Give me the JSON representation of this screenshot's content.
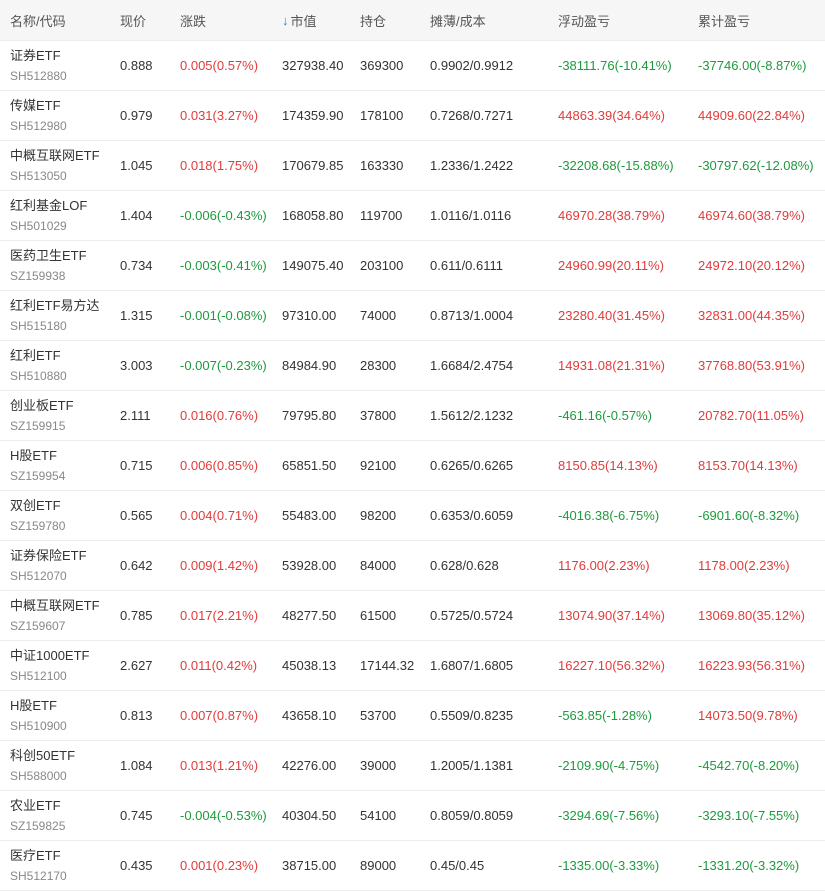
{
  "colors": {
    "up": "#e03b3b",
    "down": "#1c9b3c",
    "sort_arrow": "#2a7fd4"
  },
  "header": {
    "name_code": "名称/代码",
    "price": "现价",
    "change": "涨跌",
    "sort_icon": "arrow-down-icon",
    "market_value": "市值",
    "holding": "持仓",
    "cost": "摊薄/成本",
    "floating_pnl": "浮动盈亏",
    "cumulative_pnl": "累计盈亏"
  },
  "rows": [
    {
      "name": "证券ETF",
      "code": "SH512880",
      "price": "0.888",
      "change": "0.005(0.57%)",
      "market_value": "327938.40",
      "holding": "369300",
      "cost": "0.9902/0.9912",
      "floating": "-38111.76(-10.41%)",
      "cumulative": "-37746.00(-8.87%)"
    },
    {
      "name": "传媒ETF",
      "code": "SH512980",
      "price": "0.979",
      "change": "0.031(3.27%)",
      "market_value": "174359.90",
      "holding": "178100",
      "cost": "0.7268/0.7271",
      "floating": "44863.39(34.64%)",
      "cumulative": "44909.60(22.84%)"
    },
    {
      "name": "中概互联网ETF",
      "code": "SH513050",
      "price": "1.045",
      "change": "0.018(1.75%)",
      "market_value": "170679.85",
      "holding": "163330",
      "cost": "1.2336/1.2422",
      "floating": "-32208.68(-15.88%)",
      "cumulative": "-30797.62(-12.08%)"
    },
    {
      "name": "红利基金LOF",
      "code": "SH501029",
      "price": "1.404",
      "change": "-0.006(-0.43%)",
      "market_value": "168058.80",
      "holding": "119700",
      "cost": "1.0116/1.0116",
      "floating": "46970.28(38.79%)",
      "cumulative": "46974.60(38.79%)"
    },
    {
      "name": "医药卫生ETF",
      "code": "SZ159938",
      "price": "0.734",
      "change": "-0.003(-0.41%)",
      "market_value": "149075.40",
      "holding": "203100",
      "cost": "0.611/0.6111",
      "floating": "24960.99(20.11%)",
      "cumulative": "24972.10(20.12%)"
    },
    {
      "name": "红利ETF易方达",
      "code": "SH515180",
      "price": "1.315",
      "change": "-0.001(-0.08%)",
      "market_value": "97310.00",
      "holding": "74000",
      "cost": "0.8713/1.0004",
      "floating": "23280.40(31.45%)",
      "cumulative": "32831.00(44.35%)"
    },
    {
      "name": "红利ETF",
      "code": "SH510880",
      "price": "3.003",
      "change": "-0.007(-0.23%)",
      "market_value": "84984.90",
      "holding": "28300",
      "cost": "1.6684/2.4754",
      "floating": "14931.08(21.31%)",
      "cumulative": "37768.80(53.91%)"
    },
    {
      "name": "创业板ETF",
      "code": "SZ159915",
      "price": "2.111",
      "change": "0.016(0.76%)",
      "market_value": "79795.80",
      "holding": "37800",
      "cost": "1.5612/2.1232",
      "floating": "-461.16(-0.57%)",
      "cumulative": "20782.70(11.05%)"
    },
    {
      "name": "H股ETF",
      "code": "SZ159954",
      "price": "0.715",
      "change": "0.006(0.85%)",
      "market_value": "65851.50",
      "holding": "92100",
      "cost": "0.6265/0.6265",
      "floating": "8150.85(14.13%)",
      "cumulative": "8153.70(14.13%)"
    },
    {
      "name": "双创ETF",
      "code": "SZ159780",
      "price": "0.565",
      "change": "0.004(0.71%)",
      "market_value": "55483.00",
      "holding": "98200",
      "cost": "0.6353/0.6059",
      "floating": "-4016.38(-6.75%)",
      "cumulative": "-6901.60(-8.32%)"
    },
    {
      "name": "证券保险ETF",
      "code": "SH512070",
      "price": "0.642",
      "change": "0.009(1.42%)",
      "market_value": "53928.00",
      "holding": "84000",
      "cost": "0.628/0.628",
      "floating": "1176.00(2.23%)",
      "cumulative": "1178.00(2.23%)"
    },
    {
      "name": "中概互联网ETF",
      "code": "SZ159607",
      "price": "0.785",
      "change": "0.017(2.21%)",
      "market_value": "48277.50",
      "holding": "61500",
      "cost": "0.5725/0.5724",
      "floating": "13074.90(37.14%)",
      "cumulative": "13069.80(35.12%)"
    },
    {
      "name": "中证1000ETF",
      "code": "SH512100",
      "price": "2.627",
      "change": "0.011(0.42%)",
      "market_value": "45038.13",
      "holding": "17144.32",
      "cost": "1.6807/1.6805",
      "floating": "16227.10(56.32%)",
      "cumulative": "16223.93(56.31%)"
    },
    {
      "name": "H股ETF",
      "code": "SH510900",
      "price": "0.813",
      "change": "0.007(0.87%)",
      "market_value": "43658.10",
      "holding": "53700",
      "cost": "0.5509/0.8235",
      "floating": "-563.85(-1.28%)",
      "cumulative": "14073.50(9.78%)"
    },
    {
      "name": "科创50ETF",
      "code": "SH588000",
      "price": "1.084",
      "change": "0.013(1.21%)",
      "market_value": "42276.00",
      "holding": "39000",
      "cost": "1.2005/1.1381",
      "floating": "-2109.90(-4.75%)",
      "cumulative": "-4542.70(-8.20%)"
    },
    {
      "name": "农业ETF",
      "code": "SZ159825",
      "price": "0.745",
      "change": "-0.004(-0.53%)",
      "market_value": "40304.50",
      "holding": "54100",
      "cost": "0.8059/0.8059",
      "floating": "-3294.69(-7.56%)",
      "cumulative": "-3293.10(-7.55%)"
    },
    {
      "name": "医疗ETF",
      "code": "SH512170",
      "price": "0.435",
      "change": "0.001(0.23%)",
      "market_value": "38715.00",
      "holding": "89000",
      "cost": "0.45/0.45",
      "floating": "-1335.00(-3.33%)",
      "cumulative": "-1331.20(-3.32%)"
    }
  ]
}
